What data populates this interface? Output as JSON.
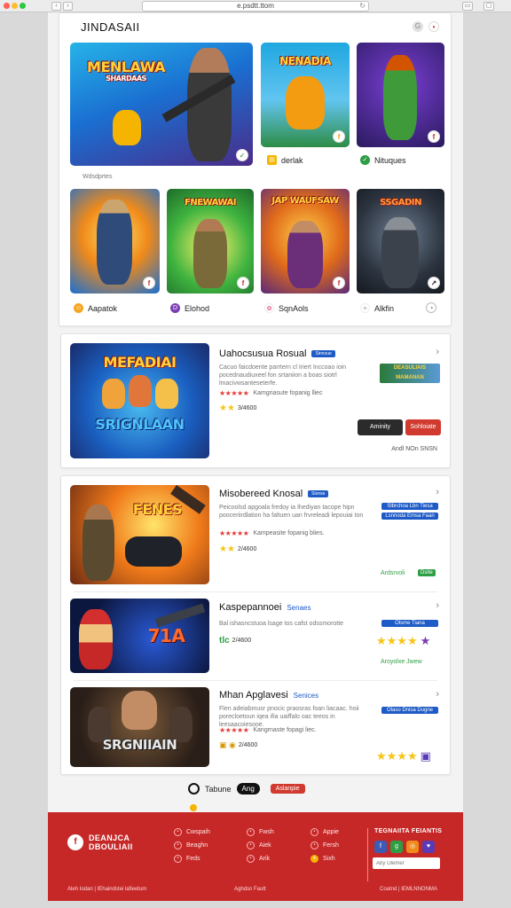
{
  "browser": {
    "url": "e.psdtt.ttom",
    "reload_icon": "↻",
    "back": "‹",
    "forward": "›"
  },
  "header": {
    "brand": "JINDASAII",
    "icon_left": "G",
    "icon_right": "•"
  },
  "featured": [
    {
      "title": "MENLAWA",
      "sub": "SHARDAAS"
    },
    {
      "title": "NENADIA"
    },
    {
      "title": ""
    }
  ],
  "featured_captions": [
    {
      "icon": "▤",
      "label": "derlak"
    },
    {
      "icon": "✓",
      "label": "Nituques"
    }
  ],
  "section_label": "Wdsdprtes",
  "grid": [
    {
      "title": "",
      "caption": "Aapatok",
      "icon": "☺",
      "badge": "f"
    },
    {
      "title": "FNEWAWAI",
      "caption": "Elohod",
      "icon": "D",
      "badge": "f"
    },
    {
      "title": "JAP WAUFSAW",
      "caption": "SqnAols",
      "icon": "✿",
      "badge": "f"
    },
    {
      "title": "SSGADIN",
      "caption": "Alkfin",
      "icon": "✧",
      "badge": "↗",
      "caption_right_icon": "◔"
    }
  ],
  "listings": [
    {
      "art_title": "MEFADIAI",
      "art_sub": "SRIGNLAAN",
      "title": "Uahocsusua Rosual",
      "tag": "Sinnoue",
      "desc": "Cacuo faicdoente parrtern cl Iriert Inccoao ioin pocednaudiuxeel fon srtaniion a boas siotrl lmacivwsanteseterfe.",
      "stars": "★★★★★",
      "star_text": "Kamgriasute fopanig lliec",
      "rating": "3/4600",
      "thumb_text": "DEASULIAIS MAMANAN",
      "btn_dark": "Aminity",
      "btn_red": "Sohloiate",
      "footer": "Andl NOn SNSN"
    },
    {
      "art_title": "FENES",
      "title": "Misobereed Knosal",
      "tag": "Sionse",
      "desc": "Peicoolsd apgoala fredoy ia Ihediyan tacope hipn pooceriirdlation ha faltuen uan frvreleadi lepouiai ton",
      "stars": "★★★★★",
      "star_text": "Kampeasite fopanig blies.",
      "rating": "2/4600",
      "pill1": "Slbrchoa Lbn Tiesa",
      "pill2": "Lsnnoda Emsa Faan",
      "footer": "Ardsrvoli",
      "footer_badge": "Dsite"
    },
    {
      "art_title": "71A",
      "title": "Kaspepannoei",
      "tag": "Senaes",
      "desc": "Bal ishasncstuoa lsage tos cafst odssmorotte",
      "rating": "2/4600",
      "tile_label": "tlc",
      "pill1": "Olsme Tiana",
      "footer": "Aroyolxe Jwew"
    },
    {
      "art_title": "SRGNIIAIN",
      "title": "Mhan Apglavesi",
      "tag": "Senices",
      "desc": "Flen adeiabmusr pnocic praosras foan liacaac. hoii porecloetoun iqea ifia uaiffalo oac teeos in leesaacoiesooe.",
      "stars": "★★★★★",
      "star_text": "Kangrnaste fopagi liec.",
      "rating": "2/4600",
      "pill1": "Olaso Dnisa Dugne"
    }
  ],
  "controls": {
    "label1": "Tabune",
    "label2": "Ang",
    "label3": "Aslanpie"
  },
  "footer": {
    "brand_line1": "DEANJCA",
    "brand_line2": "DBOULIAII",
    "links_col1": [
      "Cwspaih",
      "Beaghn",
      "Feds"
    ],
    "links_col2": [
      "Fwsh",
      "Aiek",
      "Arik"
    ],
    "links_col3": [
      "Appie",
      "Fersh",
      "Sixh"
    ],
    "social_title": "TEGNAIITA FEIANTIS",
    "search_placeholder": "Aby Olemer",
    "bottom_left": "Aleh Iodan | IEhaindstei lafieetum",
    "bottom_center": "Aghdsn Fautt",
    "bottom_right": "Coatnd | IEMLNNONMA",
    "brand_color": "#c62828",
    "accent_blue": "#1e5bc6"
  }
}
